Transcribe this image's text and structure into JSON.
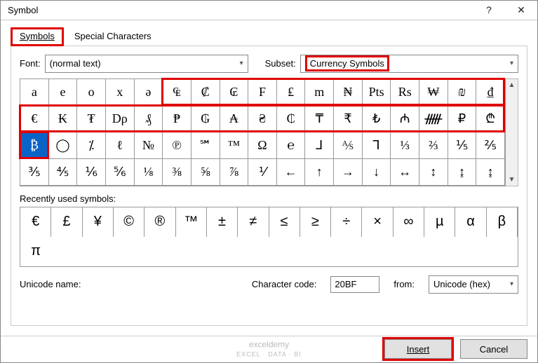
{
  "title": "Symbol",
  "help_glyph": "?",
  "close_glyph": "✕",
  "tabs": {
    "symbols": "Symbols",
    "special": "Special Characters"
  },
  "font_label": "Font:",
  "font_value": "(normal text)",
  "subset_label": "Subset:",
  "subset_value": "Currency Symbols",
  "grid": {
    "row0": [
      "a",
      "e",
      "o",
      "x",
      "ə",
      "₠",
      "₡",
      "₢",
      "F",
      "₤",
      "m",
      "₦",
      "Pts",
      "Rs",
      "₩",
      "₪",
      "₫"
    ],
    "row1": [
      "€",
      "₭",
      "₮",
      "Dρ",
      "₰",
      "₱",
      "₲",
      "₳",
      "₴",
      "₵",
      "₸",
      "₹",
      "₺",
      "₼",
      "ᚏ",
      "₽",
      "₾"
    ],
    "row2": [
      "₿",
      "◯",
      "⁒",
      "ℓ",
      "№",
      "℗",
      "℠",
      "™",
      "Ω",
      "℮",
      "⅃",
      "⅍",
      "⅂",
      "⅓",
      "⅔",
      "⅕",
      "⅖"
    ],
    "row3": [
      "⅗",
      "⅘",
      "⅙",
      "⅚",
      "⅛",
      "⅜",
      "⅝",
      "⅞",
      "⅟",
      "←",
      "↑",
      "→",
      "↓",
      "↔",
      "↕",
      "↨",
      "↨"
    ]
  },
  "selected_index": 34,
  "recent_label": "Recently used symbols:",
  "recent": [
    "€",
    "£",
    "¥",
    "©",
    "®",
    "™",
    "±",
    "≠",
    "≤",
    "≥",
    "÷",
    "×",
    "∞",
    "µ",
    "α",
    "β",
    "π"
  ],
  "unicode_name_label": "Unicode name:",
  "charcode_label": "Character code:",
  "charcode_value": "20BF",
  "from_label": "from:",
  "from_value": "Unicode (hex)",
  "insert_label": "Insert",
  "cancel_label": "Cancel",
  "watermark": {
    "line1": "exceldemy",
    "line2": "EXCEL · DATA · BI"
  }
}
